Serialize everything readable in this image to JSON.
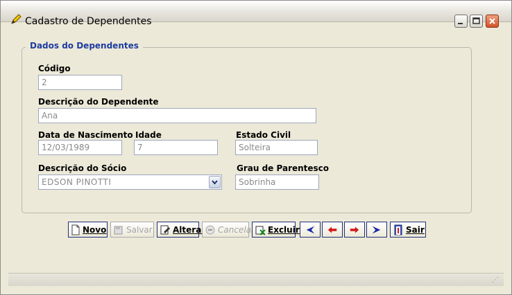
{
  "window": {
    "title": "Cadastro de Dependentes"
  },
  "group": {
    "title": "Dados do  Dependentes"
  },
  "fields": {
    "codigo": {
      "label": "Código",
      "value": "2"
    },
    "descricao": {
      "label": "Descrição do Dependente",
      "value": "Ana"
    },
    "nascimento": {
      "label": "Data de Nascimento",
      "value": "12/03/1989"
    },
    "idade": {
      "label": "Idade",
      "value": "7"
    },
    "estado_civil": {
      "label": "Estado Civil",
      "value": "Solteira"
    },
    "socio": {
      "label": "Descrição do Sócio",
      "value": "EDSON PINOTTI"
    },
    "parentesco": {
      "label": "Grau de Parentesco",
      "value": "Sobrinha"
    }
  },
  "toolbar": {
    "novo": "Novo",
    "salvar": "Salvar",
    "alterar": "Alterar",
    "cancelar": "Cancelar",
    "excluir": "Excluir",
    "sair": "Sair"
  },
  "icons": {
    "app": "pencil-app-icon",
    "minimize": "minimize-icon",
    "maximize": "maximize-icon",
    "close": "close-icon",
    "first": "first-record-icon",
    "prev": "previous-record-icon",
    "next": "next-record-icon",
    "last": "last-record-icon",
    "exit": "exit-door-icon"
  },
  "colors": {
    "group_title": "#1e3c9f",
    "close_button": "#d2522a",
    "nav_blue": "#1f2aa5",
    "nav_red": "#d21818"
  }
}
